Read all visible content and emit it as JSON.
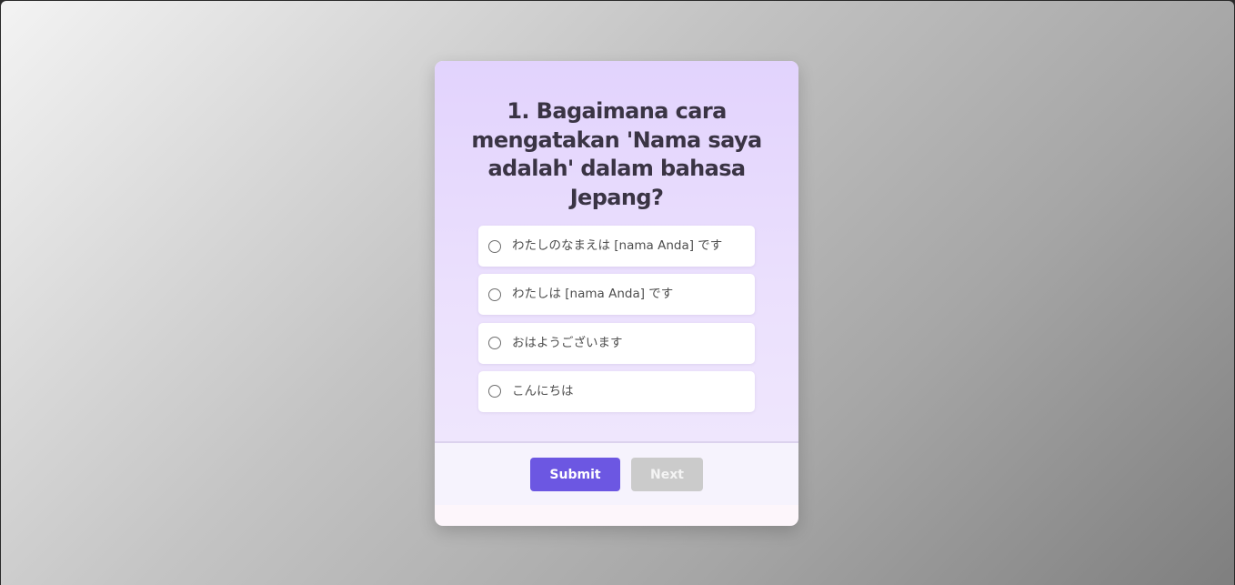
{
  "quiz": {
    "question": "1. Bagaimana cara mengatakan 'Nama saya adalah' dalam bahasa Jepang?",
    "options": [
      {
        "label": "わたしのなまえは [nama Anda] です"
      },
      {
        "label": "わたしは [nama Anda] です"
      },
      {
        "label": "おはようございます"
      },
      {
        "label": "こんにちは"
      }
    ],
    "submit_label": "Submit",
    "next_label": "Next"
  },
  "colors": {
    "accent": "#6c57e2",
    "disabled": "#cbcbcb",
    "card_top": "#e2d3fd"
  }
}
